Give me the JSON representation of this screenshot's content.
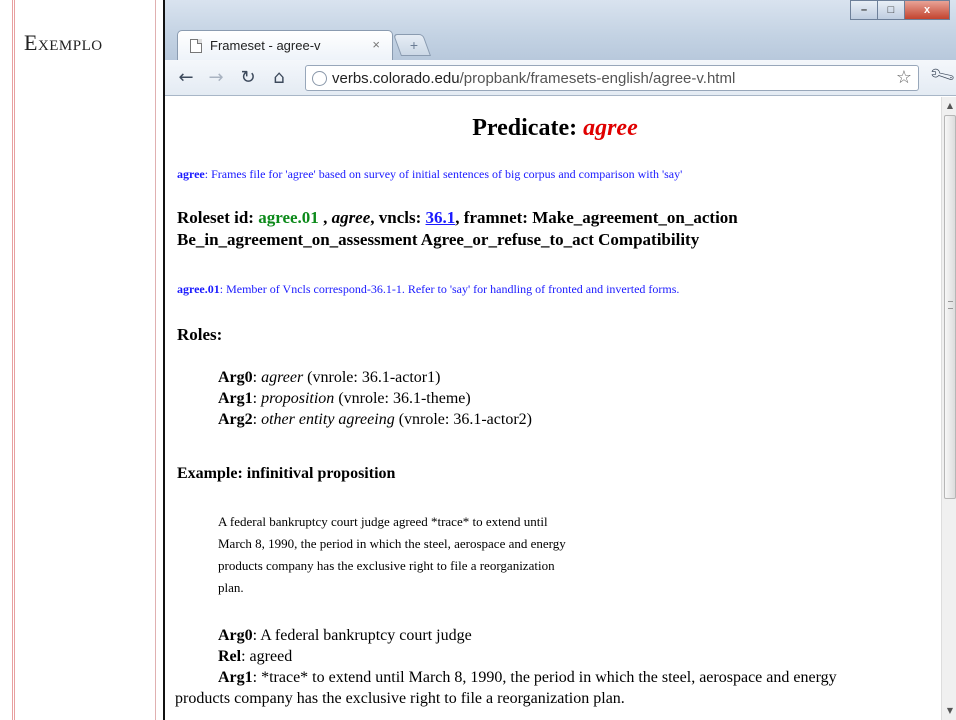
{
  "slide": {
    "label": "Exemplo"
  },
  "browser": {
    "tab_title": "Frameset - agree-v",
    "tab_close": "×",
    "new_tab": "+",
    "window_controls": {
      "minimize": "–",
      "maximize": "□",
      "close": "x"
    },
    "url_domain": "verbs.colorado.edu",
    "url_path": "/propbank/framesets-english/agree-v.html",
    "icons": [
      "back-icon",
      "forward-icon",
      "reload-icon",
      "home-icon",
      "globe-icon",
      "star-icon",
      "wrench-icon",
      "document-icon"
    ]
  },
  "page": {
    "heading_prefix": "Predicate: ",
    "heading_lemma": "agree",
    "frames_desc_lemma": "agree",
    "frames_desc_text": ": Frames file for 'agree' based on survey of initial sentences of big corpus and comparison with 'say'",
    "roleset": {
      "prefix": "Roleset id: ",
      "id": "agree.01",
      "sep1": " , ",
      "name": "agree",
      "vncls_prefix": ", vncls: ",
      "vncls": "36.1",
      "framenet_prefix": ", framnet: Make_agreement_on_action",
      "framenet_rest": "Be_in_agreement_on_assessment Agree_or_refuse_to_act Compatibility"
    },
    "roleset_note_id": "agree.01",
    "roleset_note_text": ": Member of Vncls correspond-36.1-1. Refer to 'say' for handling of fronted and inverted forms.",
    "roles_heading": "Roles:",
    "roles": [
      {
        "arg": "Arg0",
        "desc": "agreer",
        "vnrole": " (vnrole: 36.1-actor1)"
      },
      {
        "arg": "Arg1",
        "desc": "proposition",
        "vnrole": " (vnrole: 36.1-theme)"
      },
      {
        "arg": "Arg2",
        "desc": "other entity agreeing",
        "vnrole": " (vnrole: 36.1-actor2)"
      }
    ],
    "example_heading": "Example: infinitival proposition",
    "example_lines": [
      "A federal bankruptcy court judge agreed *trace* to extend until",
      "March 8, 1990, the period in which the steel, aerospace and energy",
      "products company has the exclusive right to file a reorganization",
      "plan."
    ],
    "example_args": {
      "arg0_label": "Arg0",
      "arg0_text": ": A federal bankruptcy court judge",
      "rel_label": "Rel",
      "rel_text": ": agreed",
      "arg1_label": "Arg1",
      "arg1_text": ": *trace* to extend until March 8, 1990, the period in which the steel, aerospace and energy",
      "arg1_cont": "products company has the exclusive right to file a reorganization plan."
    }
  }
}
